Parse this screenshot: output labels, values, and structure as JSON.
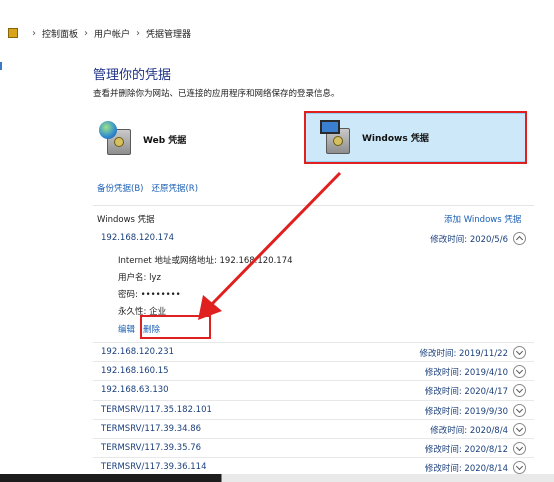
{
  "breadcrumb": [
    "控制面板",
    "用户帐户",
    "凭据管理器"
  ],
  "header": {
    "title": "管理你的凭据",
    "description": "查看并删除你为网站、已连接的应用程序和网络保存的登录信息。"
  },
  "credential_types": {
    "web": "Web 凭据",
    "windows": "Windows 凭据"
  },
  "actions": {
    "backup": "备份凭据(B)",
    "restore": "还原凭据(R)"
  },
  "section": {
    "label": "Windows 凭据",
    "add": "添加 Windows 凭据"
  },
  "expanded": {
    "address": "192.168.120.174",
    "date": "修改时间: 2020/5/6",
    "fields": {
      "net_address": "Internet 地址或网络地址: 192.168.120.174",
      "username": "用户名: lyz",
      "password": "密码: ••••••••",
      "persistence": "永久性: 企业"
    },
    "edit": "编辑",
    "delete": "删除"
  },
  "rows": [
    {
      "address": "192.168.120.231",
      "date": "修改时间: 2019/11/22"
    },
    {
      "address": "192.168.160.15",
      "date": "修改时间: 2019/4/10"
    },
    {
      "address": "192.168.63.130",
      "date": "修改时间: 2020/4/17"
    },
    {
      "address": "TERMSRV/117.35.182.101",
      "date": "修改时间: 2019/9/30"
    },
    {
      "address": "TERMSRV/117.39.34.86",
      "date": "修改时间: 2020/8/4"
    },
    {
      "address": "TERMSRV/117.39.35.76",
      "date": "修改时间: 2020/8/12"
    },
    {
      "address": "TERMSRV/117.39.36.114",
      "date": "修改时间: 2020/8/14"
    }
  ],
  "colors": {
    "accent": "#1a5fb4",
    "selected_card": "#cde8f8",
    "annotation_red": "#e0201f"
  },
  "icons": [
    "control-panel-icon",
    "web-credential-icon",
    "windows-credential-icon",
    "chevron-icon"
  ]
}
